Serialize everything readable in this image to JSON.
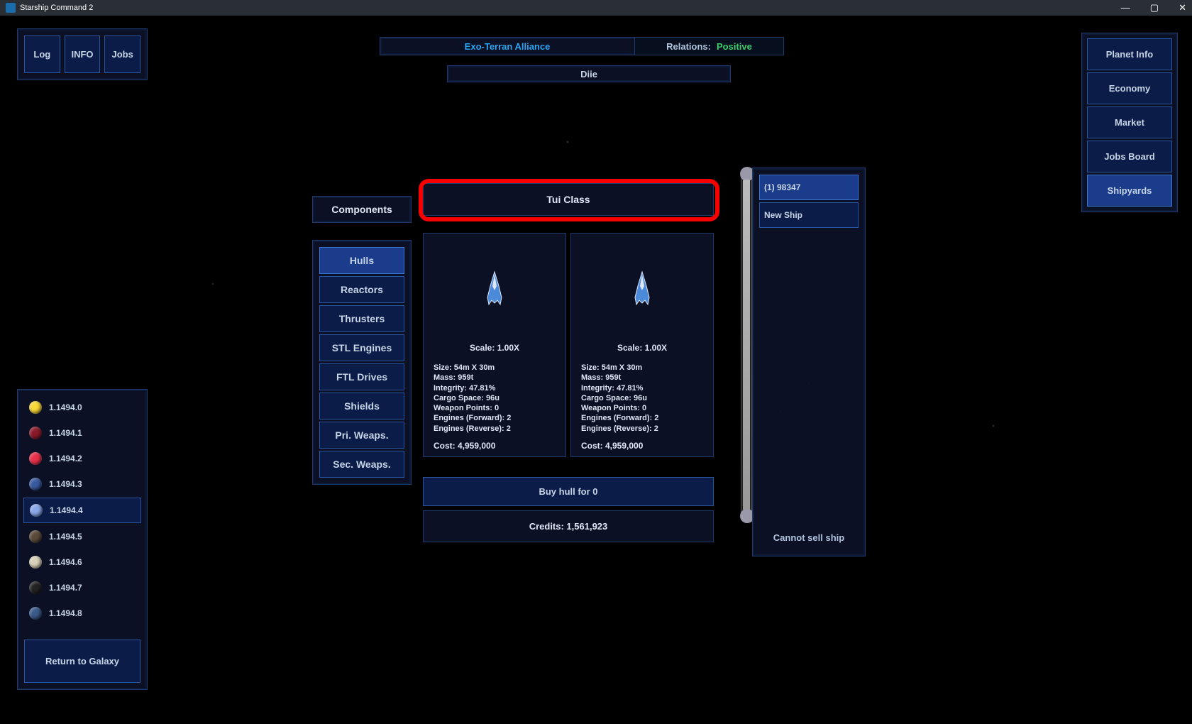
{
  "window_title": "Starship Command 2",
  "top_buttons": [
    "Log",
    "INFO",
    "Jobs"
  ],
  "faction": {
    "name": "Exo-Terran Alliance",
    "rel_label": "Relations:",
    "rel_value": "Positive"
  },
  "location": "Diie",
  "right_menu": [
    "Planet Info",
    "Economy",
    "Market",
    "Jobs Board",
    "Shipyards"
  ],
  "right_menu_selected": 4,
  "planets": [
    "1.1494.0",
    "1.1494.1",
    "1.1494.2",
    "1.1494.3",
    "1.1494.4",
    "1.1494.5",
    "1.1494.6",
    "1.1494.7",
    "1.1494.8"
  ],
  "planet_colors": [
    "#f8d838",
    "#8a1a2a",
    "#e8304a",
    "#3a5aa0",
    "#8aa8e8",
    "#5a4a3a",
    "#d8d0b8",
    "#222",
    "#3a5a8a"
  ],
  "planet_selected": 4,
  "return_label": "Return to Galaxy",
  "components_header": "Components",
  "component_cats": [
    "Hulls",
    "Reactors",
    "Thrusters",
    "STL Engines",
    "FTL Drives",
    "Shields",
    "Pri. Weaps.",
    "Sec. Weaps."
  ],
  "component_selected": 0,
  "class_header": "Tui Class",
  "ship_card": {
    "scale": "Scale: 1.00X",
    "size": "Size: 54m X 30m",
    "mass": "Mass: 959t",
    "integrity": "Integrity: 47.81%",
    "cargo": "Cargo Space: 96u",
    "weapons": "Weapon Points: 0",
    "eng_f": "Engines (Forward): 2",
    "eng_r": "Engines (Reverse): 2",
    "cost": "Cost: 4,959,000"
  },
  "buy_label": "Buy hull for 0",
  "credits": "Credits: 1,561,923",
  "ship_slots": [
    "(1) 98347",
    "New Ship"
  ],
  "ship_slot_selected": 0,
  "cannot_sell": "Cannot sell ship"
}
